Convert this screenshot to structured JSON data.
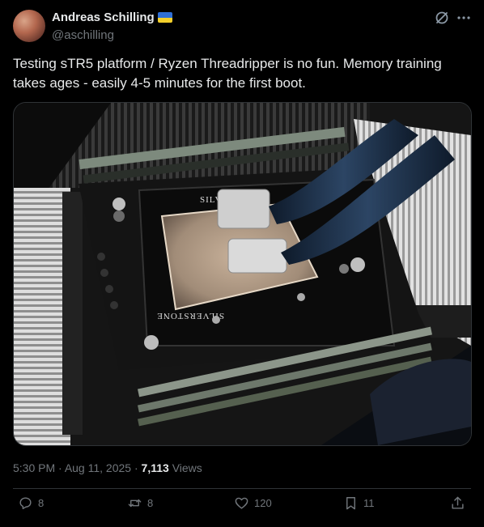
{
  "author": {
    "name": "Andreas Schilling",
    "handle": "@aschilling",
    "flag_icon": "ukraine-flag-icon"
  },
  "header_icons": {
    "grok": "grok-icon",
    "more": "more-icon"
  },
  "tweet": {
    "text": "Testing sTR5 platform / Ryzen Threadripper is no fun. Memory training takes ages - easily 4-5 minutes for the first boot."
  },
  "media": {
    "image_brand_text": "SILVERSTONE",
    "alt_description": "photo of a cpu water block on a Threadripper motherboard"
  },
  "meta": {
    "time": "5:30 PM",
    "date": "Aug 11, 2025",
    "views_count": "7,113",
    "views_label": "Views"
  },
  "actions": {
    "reply_count": "8",
    "repost_count": "8",
    "like_count": "120",
    "bookmark_count": "11"
  },
  "colors": {
    "background": "#000000",
    "text": "#e7e9ea",
    "secondary": "#71767b",
    "divider": "#2f3336"
  }
}
